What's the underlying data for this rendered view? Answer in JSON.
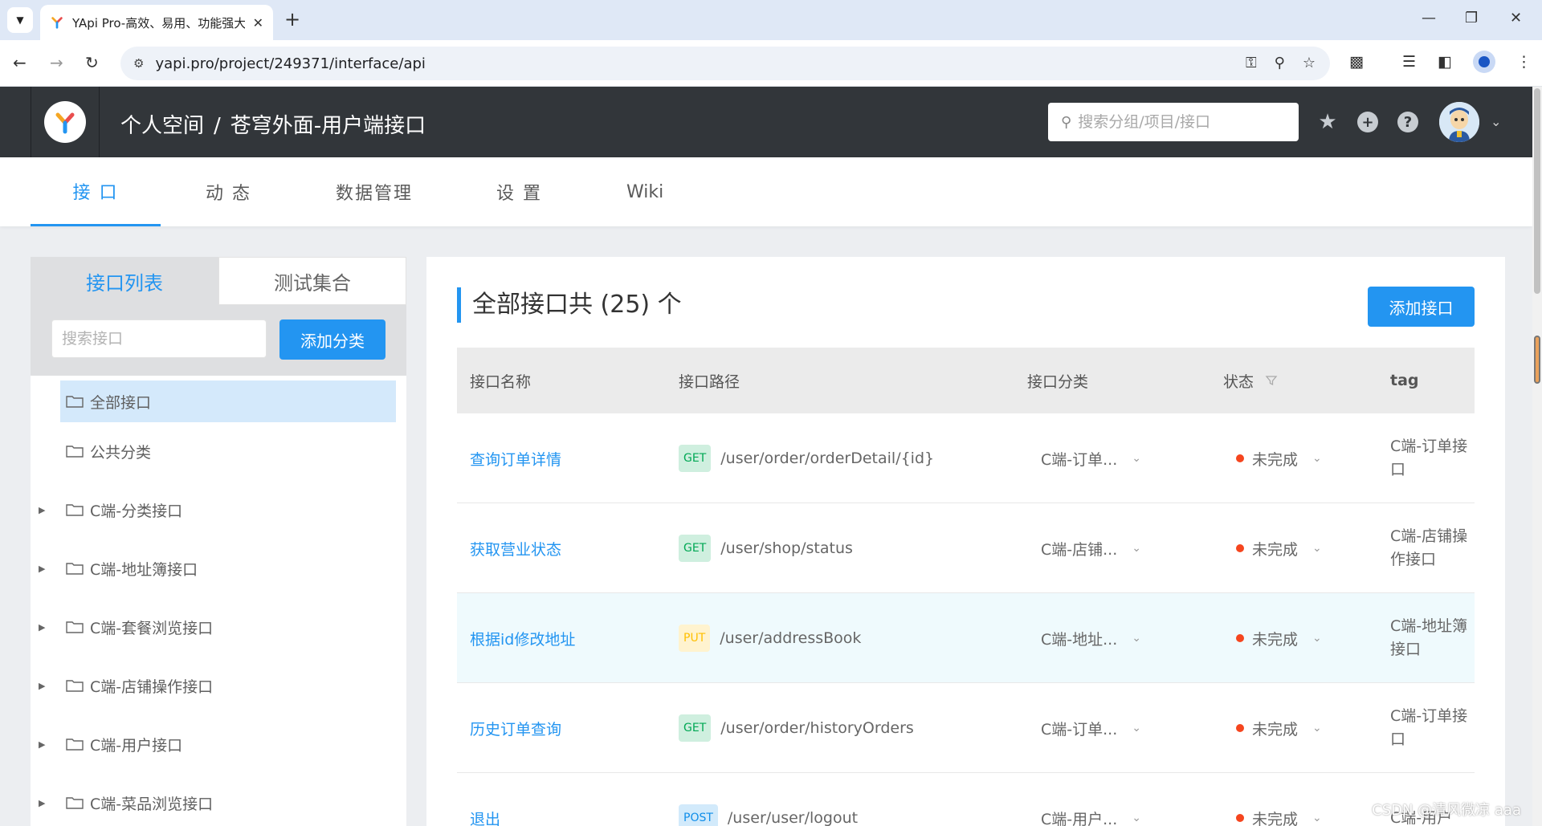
{
  "browser": {
    "tab_title": "YApi Pro-高效、易用、功能强大的",
    "url": "yapi.pro/project/249371/interface/api"
  },
  "header": {
    "crumb_space": "个人空间",
    "crumb_sep": "/",
    "crumb_project": "苍穹外面-用户端接口",
    "search_placeholder": "搜索分组/项目/接口"
  },
  "subnav": {
    "tabs": [
      {
        "label": "接 口"
      },
      {
        "label": "动 态"
      },
      {
        "label": "数据管理"
      },
      {
        "label": "设 置"
      },
      {
        "label": "Wiki"
      }
    ]
  },
  "left_panel": {
    "tab_list": "接口列表",
    "tab_test": "测试集合",
    "search_placeholder": "搜索接口",
    "add_category": "添加分类",
    "tree": [
      {
        "label": "全部接口"
      },
      {
        "label": "公共分类"
      },
      {
        "label": "C端-分类接口"
      },
      {
        "label": "C端-地址簿接口"
      },
      {
        "label": "C端-套餐浏览接口"
      },
      {
        "label": "C端-店铺操作接口"
      },
      {
        "label": "C端-用户接口"
      },
      {
        "label": "C端-菜品浏览接口"
      }
    ]
  },
  "main": {
    "title": "全部接口共 (25) 个",
    "add_api": "添加接口",
    "columns": {
      "name": "接口名称",
      "path": "接口路径",
      "category": "接口分类",
      "status": "状态",
      "tag": "tag"
    },
    "rows": [
      {
        "name": "查询订单详情",
        "method": "GET",
        "path": "/user/order/orderDetail/{id}",
        "category": "C端-订单...",
        "status": "未完成",
        "tag": "C端-订单接口"
      },
      {
        "name": "获取营业状态",
        "method": "GET",
        "path": "/user/shop/status",
        "category": "C端-店铺...",
        "status": "未完成",
        "tag": "C端-店铺操作接口"
      },
      {
        "name": "根据id修改地址",
        "method": "PUT",
        "path": "/user/addressBook",
        "category": "C端-地址...",
        "status": "未完成",
        "tag": "C端-地址簿接口"
      },
      {
        "name": "历史订单查询",
        "method": "GET",
        "path": "/user/order/historyOrders",
        "category": "C端-订单...",
        "status": "未完成",
        "tag": "C端-订单接口"
      },
      {
        "name": "退出",
        "method": "POST",
        "path": "/user/user/logout",
        "category": "C端-用户...",
        "status": "未完成",
        "tag": "C端-用户"
      }
    ]
  },
  "watermark": "CSDN @清风微凉 aaa",
  "colors": {
    "accent": "#2395f1",
    "header_bg": "#32363a",
    "status_incomplete": "#f5451e",
    "get_bg": "#cfefdf",
    "put_bg": "#fff3cf",
    "post_bg": "#d2eafb"
  }
}
